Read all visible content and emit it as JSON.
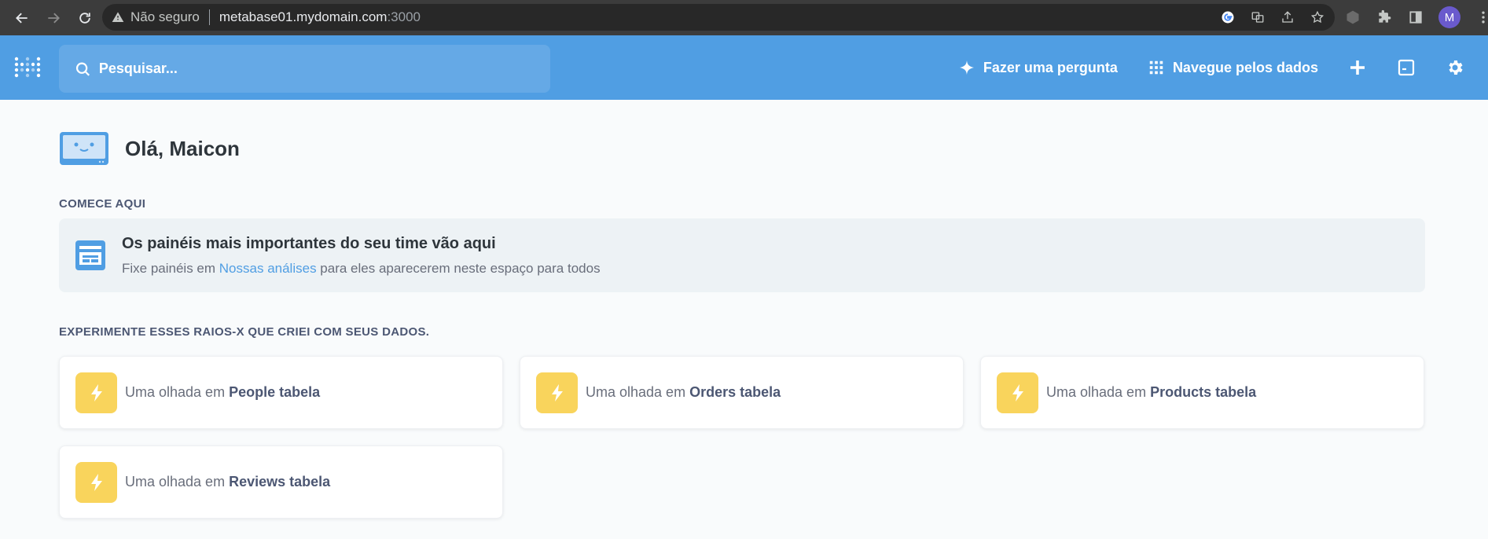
{
  "browser": {
    "insecure_label": "Não seguro",
    "url_host": "metabase01.mydomain.com",
    "url_port": ":3000",
    "profile_initial": "M"
  },
  "header": {
    "search_placeholder": "Pesquisar...",
    "ask_question_label": "Fazer uma pergunta",
    "browse_data_label": "Navegue pelos dados"
  },
  "main": {
    "greeting": "Olá, Maicon",
    "start_section_title": "COMECE AQUI",
    "start_card": {
      "title": "Os painéis mais importantes do seu time vão aqui",
      "desc_before": "Fixe painéis em ",
      "desc_link": "Nossas análises",
      "desc_after": " para eles aparecerem neste espaço para todos"
    },
    "xray_section_title": "EXPERIMENTE ESSES RAIOS-X QUE CRIEI COM SEUS DADOS.",
    "xray_prefix": "Uma olhada em ",
    "xrays": [
      {
        "name": "People tabela"
      },
      {
        "name": "Orders tabela"
      },
      {
        "name": "Products tabela"
      },
      {
        "name": "Reviews tabela"
      }
    ]
  },
  "colors": {
    "brand": "#509ee3",
    "bolt_bg": "#f9d45c",
    "page_bg": "#f9fbfc"
  }
}
